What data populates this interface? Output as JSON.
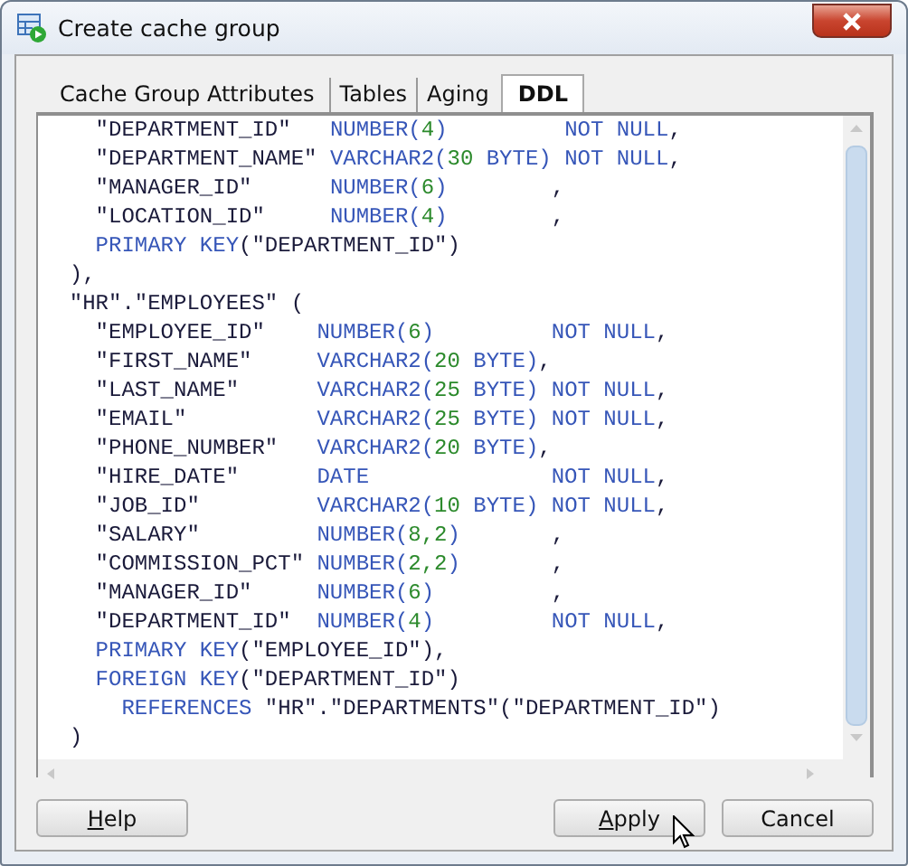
{
  "window": {
    "title": "Create cache group"
  },
  "tabs": [
    {
      "label": "Cache Group Attributes",
      "selected": false
    },
    {
      "label": "Tables",
      "selected": false
    },
    {
      "label": "Aging",
      "selected": false
    },
    {
      "label": "DDL",
      "selected": true
    }
  ],
  "ddl_lines": [
    [
      {
        "kind": "text",
        "text": "    \"DEPARTMENT_ID\"   "
      },
      {
        "kind": "keyword",
        "text": "NUMBER("
      },
      {
        "kind": "number",
        "text": "4"
      },
      {
        "kind": "keyword",
        "text": ")         NOT NULL"
      },
      {
        "kind": "text",
        "text": ","
      }
    ],
    [
      {
        "kind": "text",
        "text": "    \"DEPARTMENT_NAME\" "
      },
      {
        "kind": "keyword",
        "text": "VARCHAR2("
      },
      {
        "kind": "number",
        "text": "30"
      },
      {
        "kind": "keyword",
        "text": " BYTE) NOT NULL"
      },
      {
        "kind": "text",
        "text": ","
      }
    ],
    [
      {
        "kind": "text",
        "text": "    \"MANAGER_ID\"      "
      },
      {
        "kind": "keyword",
        "text": "NUMBER("
      },
      {
        "kind": "number",
        "text": "6"
      },
      {
        "kind": "keyword",
        "text": ")"
      },
      {
        "kind": "text",
        "text": "        ,"
      }
    ],
    [
      {
        "kind": "text",
        "text": "    \"LOCATION_ID\"     "
      },
      {
        "kind": "keyword",
        "text": "NUMBER("
      },
      {
        "kind": "number",
        "text": "4"
      },
      {
        "kind": "keyword",
        "text": ")"
      },
      {
        "kind": "text",
        "text": "        ,"
      }
    ],
    [
      {
        "kind": "keyword",
        "text": "    PRIMARY KEY"
      },
      {
        "kind": "text",
        "text": "(\"DEPARTMENT_ID\")"
      }
    ],
    [
      {
        "kind": "text",
        "text": "  ),"
      }
    ],
    [
      {
        "kind": "text",
        "text": "  \"HR\".\"EMPLOYEES\" ("
      }
    ],
    [
      {
        "kind": "text",
        "text": "    \"EMPLOYEE_ID\"    "
      },
      {
        "kind": "keyword",
        "text": "NUMBER("
      },
      {
        "kind": "number",
        "text": "6"
      },
      {
        "kind": "keyword",
        "text": ")         NOT NULL"
      },
      {
        "kind": "text",
        "text": ","
      }
    ],
    [
      {
        "kind": "text",
        "text": "    \"FIRST_NAME\"     "
      },
      {
        "kind": "keyword",
        "text": "VARCHAR2("
      },
      {
        "kind": "number",
        "text": "20"
      },
      {
        "kind": "keyword",
        "text": " BYTE)"
      },
      {
        "kind": "text",
        "text": ","
      }
    ],
    [
      {
        "kind": "text",
        "text": "    \"LAST_NAME\"      "
      },
      {
        "kind": "keyword",
        "text": "VARCHAR2("
      },
      {
        "kind": "number",
        "text": "25"
      },
      {
        "kind": "keyword",
        "text": " BYTE) NOT NULL"
      },
      {
        "kind": "text",
        "text": ","
      }
    ],
    [
      {
        "kind": "text",
        "text": "    \"EMAIL\"          "
      },
      {
        "kind": "keyword",
        "text": "VARCHAR2("
      },
      {
        "kind": "number",
        "text": "25"
      },
      {
        "kind": "keyword",
        "text": " BYTE) NOT NULL"
      },
      {
        "kind": "text",
        "text": ","
      }
    ],
    [
      {
        "kind": "text",
        "text": "    \"PHONE_NUMBER\"   "
      },
      {
        "kind": "keyword",
        "text": "VARCHAR2("
      },
      {
        "kind": "number",
        "text": "20"
      },
      {
        "kind": "keyword",
        "text": " BYTE)"
      },
      {
        "kind": "text",
        "text": ","
      }
    ],
    [
      {
        "kind": "text",
        "text": "    \"HIRE_DATE\"      "
      },
      {
        "kind": "keyword",
        "text": "DATE              NOT NULL"
      },
      {
        "kind": "text",
        "text": ","
      }
    ],
    [
      {
        "kind": "text",
        "text": "    \"JOB_ID\"         "
      },
      {
        "kind": "keyword",
        "text": "VARCHAR2("
      },
      {
        "kind": "number",
        "text": "10"
      },
      {
        "kind": "keyword",
        "text": " BYTE) NOT NULL"
      },
      {
        "kind": "text",
        "text": ","
      }
    ],
    [
      {
        "kind": "text",
        "text": "    \"SALARY\"         "
      },
      {
        "kind": "keyword",
        "text": "NUMBER("
      },
      {
        "kind": "number",
        "text": "8,2"
      },
      {
        "kind": "keyword",
        "text": ")"
      },
      {
        "kind": "text",
        "text": "       ,"
      }
    ],
    [
      {
        "kind": "text",
        "text": "    \"COMMISSION_PCT\" "
      },
      {
        "kind": "keyword",
        "text": "NUMBER("
      },
      {
        "kind": "number",
        "text": "2,2"
      },
      {
        "kind": "keyword",
        "text": ")"
      },
      {
        "kind": "text",
        "text": "       ,"
      }
    ],
    [
      {
        "kind": "text",
        "text": "    \"MANAGER_ID\"     "
      },
      {
        "kind": "keyword",
        "text": "NUMBER("
      },
      {
        "kind": "number",
        "text": "6"
      },
      {
        "kind": "keyword",
        "text": ")"
      },
      {
        "kind": "text",
        "text": "         ,"
      }
    ],
    [
      {
        "kind": "text",
        "text": "    \"DEPARTMENT_ID\"  "
      },
      {
        "kind": "keyword",
        "text": "NUMBER("
      },
      {
        "kind": "number",
        "text": "4"
      },
      {
        "kind": "keyword",
        "text": ")         NOT NULL"
      },
      {
        "kind": "text",
        "text": ","
      }
    ],
    [
      {
        "kind": "keyword",
        "text": "    PRIMARY KEY"
      },
      {
        "kind": "text",
        "text": "(\"EMPLOYEE_ID\"),"
      }
    ],
    [
      {
        "kind": "keyword",
        "text": "    FOREIGN KEY"
      },
      {
        "kind": "text",
        "text": "(\"DEPARTMENT_ID\")"
      }
    ],
    [
      {
        "kind": "keyword",
        "text": "      REFERENCES"
      },
      {
        "kind": "text",
        "text": " \"HR\".\"DEPARTMENTS\"(\"DEPARTMENT_ID\")"
      }
    ],
    [
      {
        "kind": "text",
        "text": "  )"
      }
    ]
  ],
  "buttons_left": [
    {
      "label": "Help",
      "first_letter_underlined": true
    }
  ],
  "buttons_right": [
    {
      "label": "Apply",
      "first_letter_underlined": true
    },
    {
      "label": "Cancel",
      "first_letter_underlined": false
    }
  ]
}
